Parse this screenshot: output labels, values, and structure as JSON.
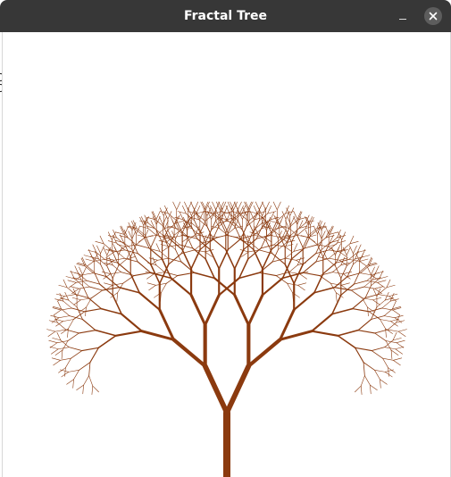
{
  "window": {
    "title": "Fractal Tree",
    "controls": {
      "minimize_icon": "minimize-icon",
      "close_icon": "close-icon"
    }
  },
  "tree": {
    "color": "#8B3A0F",
    "branch_angle_degrees": 25,
    "depth": 10,
    "length_ratio": 0.8
  }
}
